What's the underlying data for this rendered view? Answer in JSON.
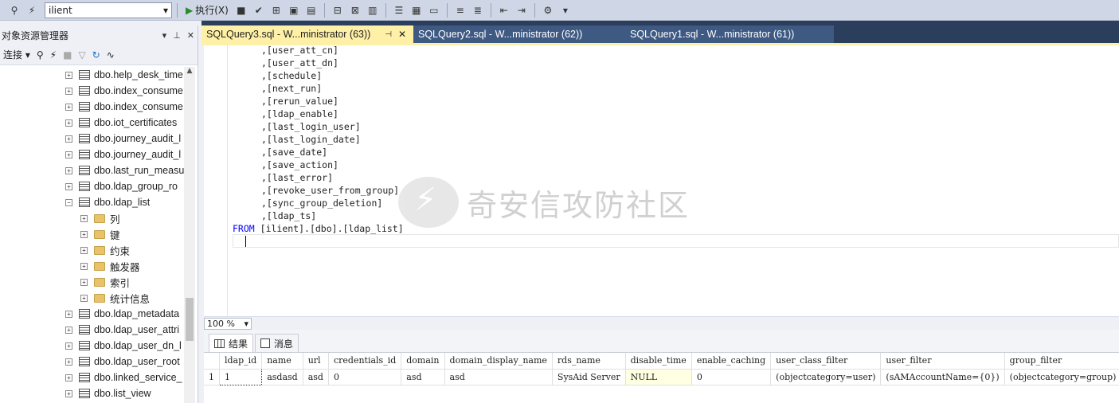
{
  "toolbar": {
    "database": "ilient",
    "execute_label": "执行(X)"
  },
  "object_explorer": {
    "title": "对象资源管理器",
    "connect_label": "连接",
    "items": [
      {
        "label": "dbo.help_desk_time",
        "type": "table",
        "expanded": false,
        "indent": 1
      },
      {
        "label": "dbo.index_consume",
        "type": "table",
        "expanded": false,
        "indent": 1
      },
      {
        "label": "dbo.index_consume",
        "type": "table",
        "expanded": false,
        "indent": 1
      },
      {
        "label": "dbo.iot_certificates",
        "type": "table",
        "expanded": false,
        "indent": 1
      },
      {
        "label": "dbo.journey_audit_l",
        "type": "table",
        "expanded": false,
        "indent": 1
      },
      {
        "label": "dbo.journey_audit_l",
        "type": "table",
        "expanded": false,
        "indent": 1
      },
      {
        "label": "dbo.last_run_measu",
        "type": "table",
        "expanded": false,
        "indent": 1
      },
      {
        "label": "dbo.ldap_group_ro",
        "type": "table",
        "expanded": false,
        "indent": 1
      },
      {
        "label": "dbo.ldap_list",
        "type": "table",
        "expanded": true,
        "indent": 1
      },
      {
        "label": "列",
        "type": "folder",
        "expanded": false,
        "indent": 2
      },
      {
        "label": "键",
        "type": "folder",
        "expanded": false,
        "indent": 2
      },
      {
        "label": "约束",
        "type": "folder",
        "expanded": false,
        "indent": 2
      },
      {
        "label": "触发器",
        "type": "folder",
        "expanded": false,
        "indent": 2
      },
      {
        "label": "索引",
        "type": "folder",
        "expanded": false,
        "indent": 2
      },
      {
        "label": "统计信息",
        "type": "folder",
        "expanded": false,
        "indent": 2
      },
      {
        "label": "dbo.ldap_metadata",
        "type": "table",
        "expanded": false,
        "indent": 1
      },
      {
        "label": "dbo.ldap_user_attri",
        "type": "table",
        "expanded": false,
        "indent": 1
      },
      {
        "label": "dbo.ldap_user_dn_l",
        "type": "table",
        "expanded": false,
        "indent": 1
      },
      {
        "label": "dbo.ldap_user_root",
        "type": "table",
        "expanded": false,
        "indent": 1
      },
      {
        "label": "dbo.linked_service_",
        "type": "table",
        "expanded": false,
        "indent": 1
      },
      {
        "label": "dbo.list_view",
        "type": "table",
        "expanded": false,
        "indent": 1
      }
    ]
  },
  "tabs": [
    {
      "label": "SQLQuery3.sql - W...ministrator (63))",
      "active": true
    },
    {
      "label": "SQLQuery2.sql - W...ministrator (62))",
      "active": false
    },
    {
      "label": "SQLQuery1.sql - W...ministrator (61))",
      "active": false
    }
  ],
  "editor": {
    "lines": [
      ",[user_att_cn]",
      ",[user_att_dn]",
      ",[schedule]",
      ",[next_run]",
      ",[rerun_value]",
      ",[ldap_enable]",
      ",[last_login_user]",
      ",[last_login_date]",
      ",[save_date]",
      ",[save_action]",
      ",[last_error]",
      ",[revoke_user_from_group]",
      ",[sync_group_deletion]",
      ",[ldap_ts]"
    ],
    "from_keyword": "FROM",
    "from_target": "[ilient].[dbo].[ldap_list]"
  },
  "watermark": "奇安信攻防社区",
  "zoom": "100 %",
  "results": {
    "tab_results": "结果",
    "tab_messages": "消息",
    "columns": [
      "ldap_id",
      "name",
      "url",
      "credentials_id",
      "domain",
      "domain_display_name",
      "rds_name",
      "disable_time",
      "enable_caching",
      "user_class_filter",
      "user_filter",
      "group_filter"
    ],
    "rows": [
      {
        "num": "1",
        "cells": [
          "1",
          "asdasd",
          "asd",
          "0",
          "asd",
          "asd",
          "SysAid Server",
          "NULL",
          "0",
          "(objectcategory=user)",
          "(sAMAccountName={0})",
          "(objectcategory=group)"
        ]
      }
    ]
  }
}
